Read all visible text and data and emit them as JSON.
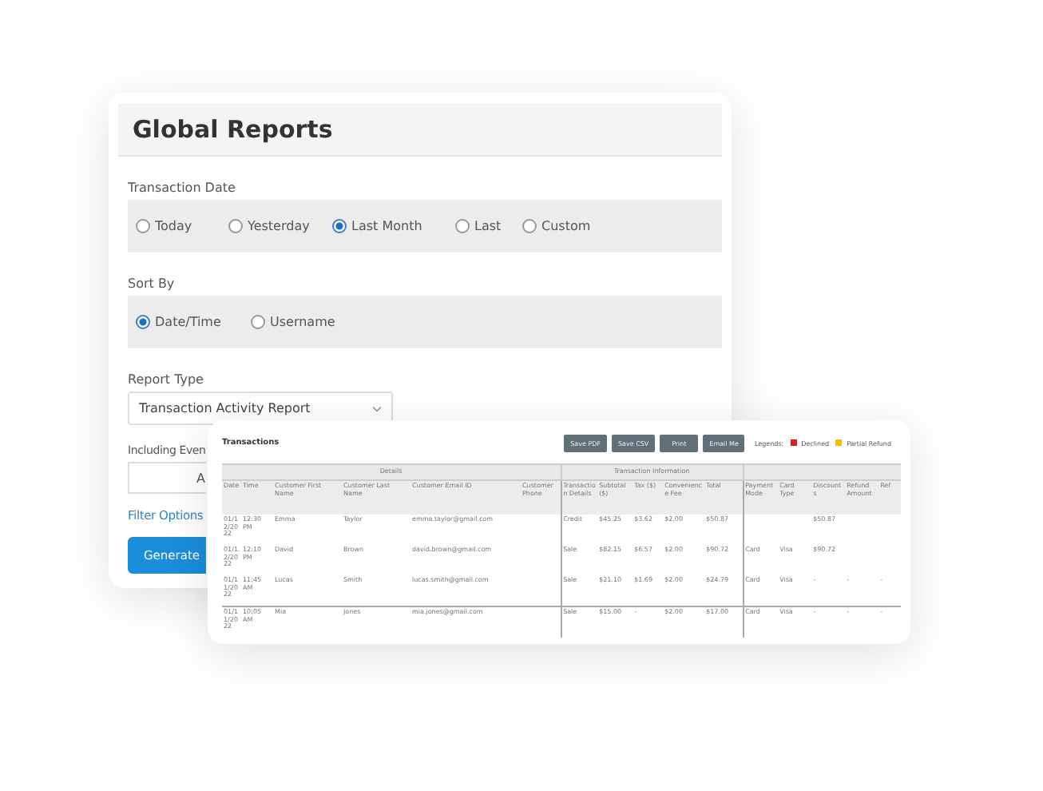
{
  "form": {
    "title": "Global Reports",
    "transaction_date": {
      "label": "Transaction Date",
      "options": [
        {
          "label": "Today",
          "selected": false
        },
        {
          "label": "Yesterday",
          "selected": false
        },
        {
          "label": "Last Month",
          "selected": true
        },
        {
          "label": "Last",
          "selected": false
        },
        {
          "label": "Custom",
          "selected": false
        }
      ]
    },
    "sort_by": {
      "label": "Sort By",
      "options": [
        {
          "label": "Date/Time",
          "selected": true
        },
        {
          "label": "Username",
          "selected": false
        }
      ]
    },
    "report_type": {
      "label": "Report Type",
      "value": "Transaction Activity Report"
    },
    "including": {
      "label": "Including Even",
      "value": "A"
    },
    "filter_link": "Filter Options",
    "generate_button": "Generate"
  },
  "report": {
    "title": "Transactions",
    "buttons": [
      "Save PDF",
      "Save CSV",
      "Print",
      "Email Me"
    ],
    "legend": {
      "label": "Legends:",
      "items": [
        {
          "label": "Declined",
          "color": "#e0201c"
        },
        {
          "label": "Partial Refund",
          "color": "#f2c200"
        }
      ]
    },
    "groups": [
      "Details",
      "Transaction Information"
    ],
    "columns": [
      "Date",
      "Time",
      "Customer First Name",
      "Customer Last Name",
      "Customer Email ID",
      "Customer Phone",
      "Transaction Details",
      "Subtotal ($)",
      "Tax ($)",
      "Convenience Fee",
      "Total",
      "Payment Mode",
      "Card Type",
      "Discounts",
      "Refund Amount",
      "Ref"
    ],
    "rows": [
      [
        "01/12/2022",
        "12:30 PM",
        "Emma",
        "Taylor",
        "emma.taylor@gmail.com",
        "",
        "Credit",
        "$45.25",
        "$3.62",
        "$2.00",
        "$50.87",
        "",
        "",
        "$50.87",
        "",
        ""
      ],
      [
        "01/12/2022",
        "12:10 PM",
        "David",
        "Brown",
        "david.brown@gmail.com",
        "",
        "Sale",
        "$82.15",
        "$6.57",
        "$2.00",
        "$90.72",
        "Card",
        "Visa",
        "$90.72",
        "",
        ""
      ],
      [
        "01/11/2022",
        "11:45 AM",
        "Lucas",
        "Smith",
        "lucas.smith@gmail.com",
        "",
        "Sale",
        "$21.10",
        "$1.69",
        "$2.00",
        "$24.79",
        "Card",
        "Visa",
        "-",
        "-",
        "-"
      ],
      [
        "01/11/2022",
        "10:05 AM",
        "Mia",
        "Jones",
        "mia.jones@gmail.com",
        "",
        "Sale",
        "$15.00",
        "-",
        "$2.00",
        "$17.00",
        "Card",
        "Visa",
        "-",
        "-",
        "-"
      ]
    ]
  }
}
